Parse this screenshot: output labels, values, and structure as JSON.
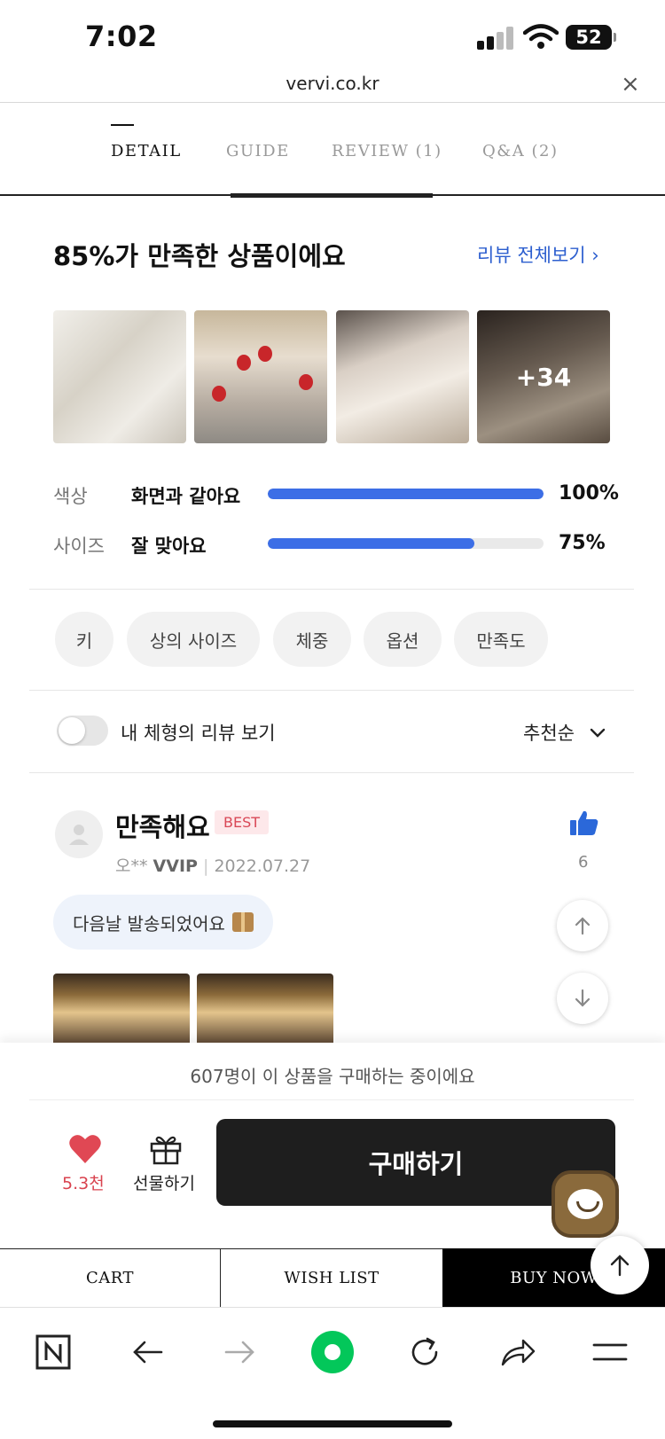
{
  "status_bar": {
    "time": "7:02",
    "battery": "52"
  },
  "browser": {
    "url": "vervi.co.kr",
    "close": "×"
  },
  "tabs": [
    {
      "label": "DETAIL"
    },
    {
      "label": "GUIDE"
    },
    {
      "label": "REVIEW (1)"
    },
    {
      "label": "Q&A (2)"
    }
  ],
  "summary": {
    "title": "85%가 만족한 상품이에요",
    "all_reviews_link": "리뷰 전체보기 ›",
    "more_photos": "+34"
  },
  "ratings": [
    {
      "label": "색상",
      "value": "화면과 같아요",
      "percent_text": "100%",
      "percent": 100
    },
    {
      "label": "사이즈",
      "value": "잘 맞아요",
      "percent_text": "75%",
      "percent": 75
    }
  ],
  "filter_chips": [
    "키",
    "상의 사이즈",
    "체중",
    "옵션",
    "만족도"
  ],
  "filter_row": {
    "toggle_label": "내 체형의 리뷰 보기",
    "sort_label": "추천순",
    "toggle_on": false
  },
  "review": {
    "title": "만족해요",
    "badge": "BEST",
    "author": "오**",
    "grade": "VVIP",
    "date": "2022.07.27",
    "likes": "6",
    "shipping_note": "다음날 발송되었어요"
  },
  "purchase": {
    "buying_now": "607명이 이 상품을 구매하는 중이에요",
    "wish_count": "5.3천",
    "gift_label": "선물하기",
    "buy_label": "구매하기"
  },
  "shop_nav": {
    "cart": "CART",
    "wishlist": "WISH LIST",
    "buy_now": "BUY NOW"
  },
  "colors": {
    "accent_blue": "#3c6ee6",
    "link_blue": "#2d5fcf",
    "heart_red": "#e04854",
    "naver_green": "#03c75a"
  },
  "icons": [
    "n-logo-icon",
    "back-icon",
    "forward-icon",
    "green-dot-icon",
    "refresh-icon",
    "share-icon",
    "menu-icon"
  ]
}
